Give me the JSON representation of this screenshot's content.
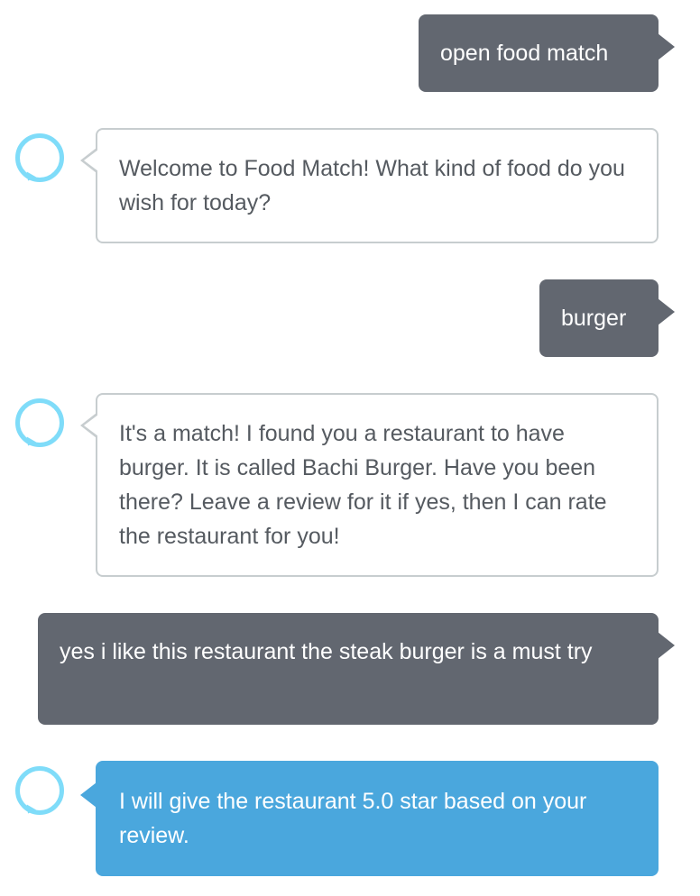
{
  "conversation": {
    "messages": [
      {
        "role": "user",
        "text": "open food match"
      },
      {
        "role": "alexa",
        "text": "Welcome to Food Match! What kind of food do you wish for today?"
      },
      {
        "role": "user",
        "text": "burger"
      },
      {
        "role": "alexa",
        "text": "It's a match! I found you a restaurant to have burger. It is called Bachi Burger. Have you been there? Leave a review for it if yes, then I can rate the restaurant for you!"
      },
      {
        "role": "user",
        "text": "yes i like this restaurant the steak burger is a must try"
      },
      {
        "role": "alexa",
        "text": "I will give the restaurant 5.0 star based on your review."
      }
    ]
  },
  "icons": {
    "assistant_avatar": "alexa-ring-icon"
  },
  "colors": {
    "user_bubble": "#626770",
    "alexa_bubble_border": "#c7cdcf",
    "alexa_active_bubble": "#4aa7dd",
    "alexa_ring": "#7fdcf9"
  }
}
